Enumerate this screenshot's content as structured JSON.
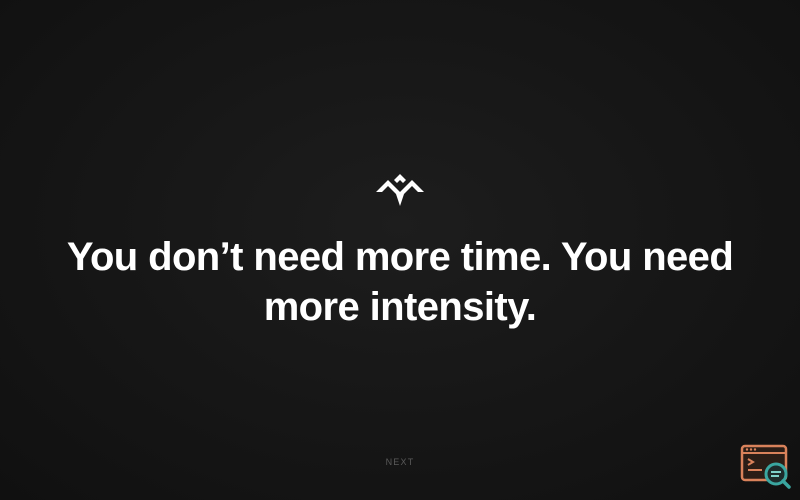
{
  "logo": {
    "icon": "mountain-logo-icon",
    "color": "#ffffff"
  },
  "headline": {
    "text": "You don’t need more time. You need more intensity."
  },
  "navigation": {
    "next_label": "NEXT"
  },
  "corner_widget": {
    "icon": "screen-search-icon",
    "accent": "#d9825b",
    "lens": "#3aa6a0"
  },
  "colors": {
    "background": "#171717",
    "text": "#ffffff",
    "muted": "#5a5a5a"
  }
}
